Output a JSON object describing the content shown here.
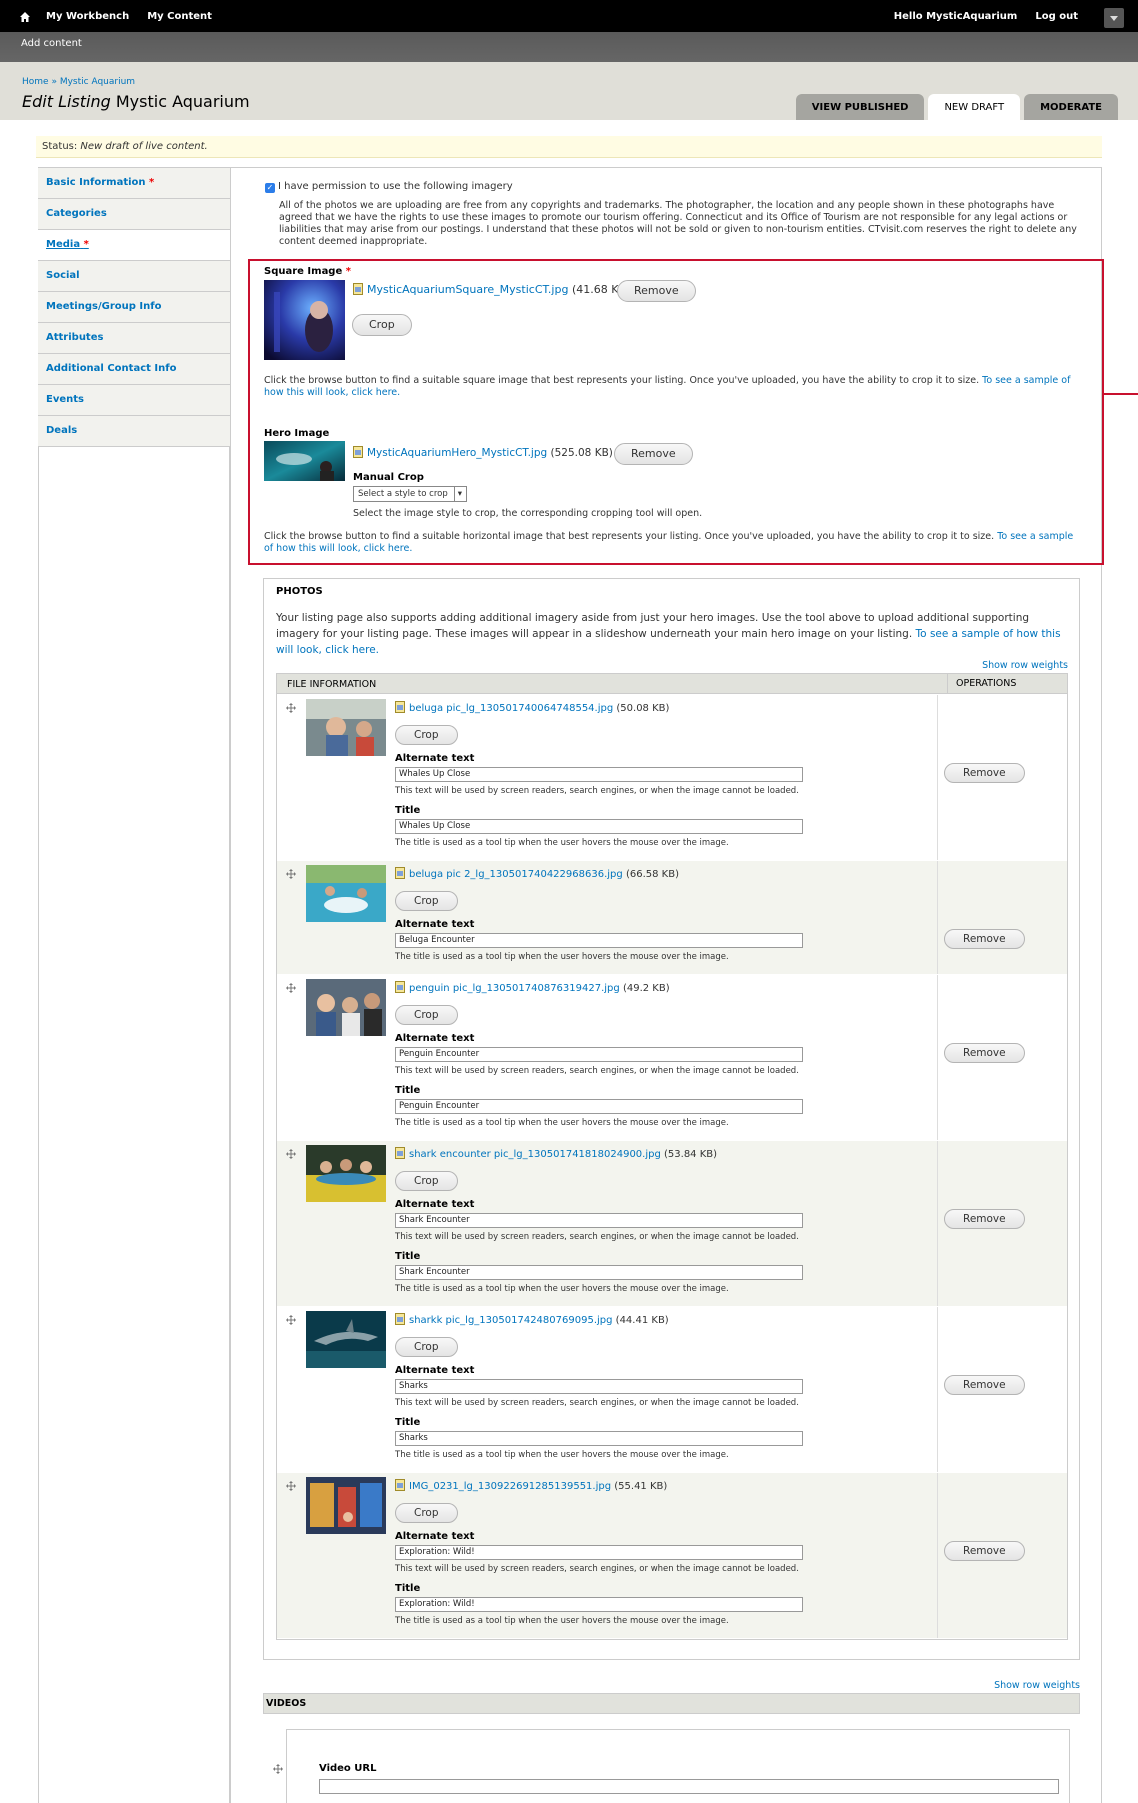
{
  "toolbar": {
    "home_icon": "home-icon",
    "menu": [
      "My Workbench",
      "My Content"
    ],
    "greeting_prefix": "Hello ",
    "username": "MysticAquarium",
    "logout": "Log out",
    "shortcut": "Add content"
  },
  "header": {
    "breadcrumb": [
      "Home",
      "Mystic Aquarium"
    ],
    "breadcrumb_sep": "»",
    "title_em": "Edit Listing",
    "title_rest": " Mystic Aquarium",
    "tabs": [
      "VIEW PUBLISHED",
      "NEW DRAFT",
      "MODERATE"
    ]
  },
  "status": {
    "prefix": "Status: ",
    "text": "New draft of live content."
  },
  "nav": [
    {
      "label": "Basic Information",
      "required": true
    },
    {
      "label": "Categories",
      "required": false
    },
    {
      "label": "Media",
      "required": true
    },
    {
      "label": "Social",
      "required": false
    },
    {
      "label": "Meetings/Group Info",
      "required": false
    },
    {
      "label": "Attributes",
      "required": false
    },
    {
      "label": "Additional Contact Info",
      "required": false
    },
    {
      "label": "Events",
      "required": false
    },
    {
      "label": "Deals",
      "required": false
    }
  ],
  "required_mark": "*",
  "permission": {
    "label": "I have permission to use the following imagery",
    "checkmark": "✓",
    "desc": "All of the photos we are uploading are free from any copyrights and trademarks. The photographer, the location and any people shown in these photographs have agreed that we have the rights to use these images to promote our tourism offering. Connecticut and its Office of Tourism are not responsible for any legal actions or liabilities that may arise from our postings. I understand that these photos will not be sold or given to non-tourism entities. CTvisit.com reserves the right to delete any content deemed inappropriate."
  },
  "square": {
    "label": "Square Image",
    "file": "MysticAquariumSquare_MysticCT.jpg",
    "size": "(41.68 KB)",
    "remove": "Remove",
    "crop": "Crop",
    "help": "Click the browse button to find a suitable square image that best represents your listing. Once you've uploaded, you have the ability to crop it to size.",
    "help_link": "To see a sample of how this will look, click here."
  },
  "hero": {
    "label": "Hero Image",
    "file": "MysticAquariumHero_MysticCT.jpg",
    "size": "(525.08 KB)",
    "remove": "Remove",
    "manual_crop": "Manual Crop",
    "select": "Select a style to crop",
    "select_arrow": "▾",
    "select_help": "Select the image style to crop, the corresponding cropping tool will open.",
    "help": "Click the browse button to find a suitable horizontal image that best represents your listing. Once you've uploaded, you have the ability to crop it to size.",
    "help_link": "To see a sample of how this will look, click here."
  },
  "photos": {
    "title": "PHOTOS",
    "desc": "Your listing page also supports adding additional imagery aside from just your hero images. Use the tool above to upload additional supporting imagery for your listing page. These images will appear in a slideshow underneath your main hero image on your listing.",
    "desc_link": "To see a sample of how this will look, click here.",
    "show_weights": "Show row weights",
    "col_file": "FILE INFORMATION",
    "col_ops": "OPERATIONS",
    "crop": "Crop",
    "remove": "Remove",
    "alt_label": "Alternate text",
    "title_label": "Title",
    "alt_help": "This text will be used by screen readers, search engines, or when the image cannot be loaded.",
    "title_help": "The title is used as a tool tip when the user hovers the mouse over the image.",
    "rows": [
      {
        "file": "beluga pic_lg_130501740064748554.jpg",
        "size": "(50.08 KB)",
        "alt": "Whales Up Close",
        "title": "Whales Up Close"
      },
      {
        "file": "beluga pic 2_lg_130501740422968636.jpg",
        "size": "(66.58 KB)",
        "alt": "Beluga Encounter"
      },
      {
        "file": "penguin pic_lg_130501740876319427.jpg",
        "size": "(49.2 KB)",
        "alt": "Penguin Encounter",
        "title": "Penguin Encounter"
      },
      {
        "file": "shark encounter pic_lg_130501741818024900.jpg",
        "size": "(53.84 KB)",
        "alt": "Shark Encounter",
        "title": "Shark Encounter"
      },
      {
        "file": "sharkk pic_lg_130501742480769095.jpg",
        "size": "(44.41 KB)",
        "alt": "Sharks",
        "title": "Sharks"
      },
      {
        "file": "IMG_0231_lg_130922691285139551.jpg",
        "size": "(55.41 KB)",
        "alt": "Exploration: Wild!",
        "title": "Exploration: Wild!"
      }
    ]
  },
  "videos": {
    "show_weights": "Show row weights",
    "title": "VIDEOS",
    "url_label": "Video URL"
  }
}
